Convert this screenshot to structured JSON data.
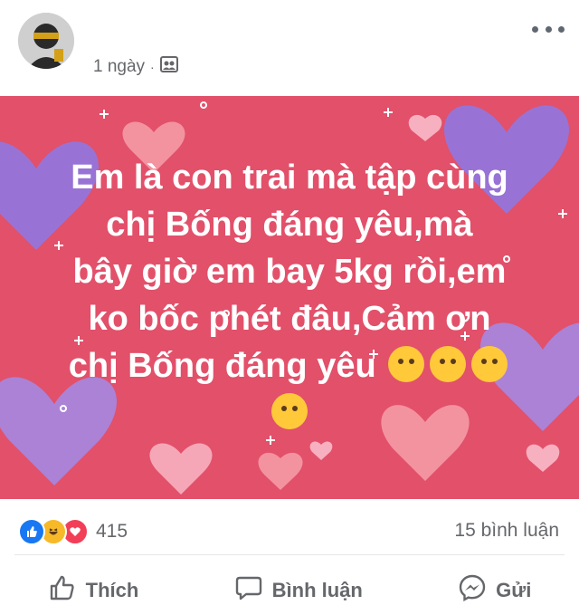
{
  "post": {
    "time": "1 ngày",
    "separator": "·",
    "privacy_icon": "friends-icon",
    "text_lines": [
      "Em là con trai mà tập cùng",
      "chị Bống đáng yêu,mà",
      "bây giờ em bay 5kg rồi,em",
      "ko bốc phét đâu,Cảm ơn",
      "chị Bống đáng yêu"
    ],
    "emojis": [
      "smiling-face-with-hearts-emoji",
      "smiling-face-with-hearts-emoji",
      "face-blowing-kiss-emoji",
      "face-blowing-kiss-emoji"
    ],
    "background_color": "#e2506a"
  },
  "stats": {
    "reaction_icons": [
      "like-icon",
      "haha-icon",
      "love-icon"
    ],
    "reaction_count": "415",
    "comment_count": "15 bình luận"
  },
  "actions": {
    "like": "Thích",
    "comment": "Bình luận",
    "send": "Gửi"
  }
}
